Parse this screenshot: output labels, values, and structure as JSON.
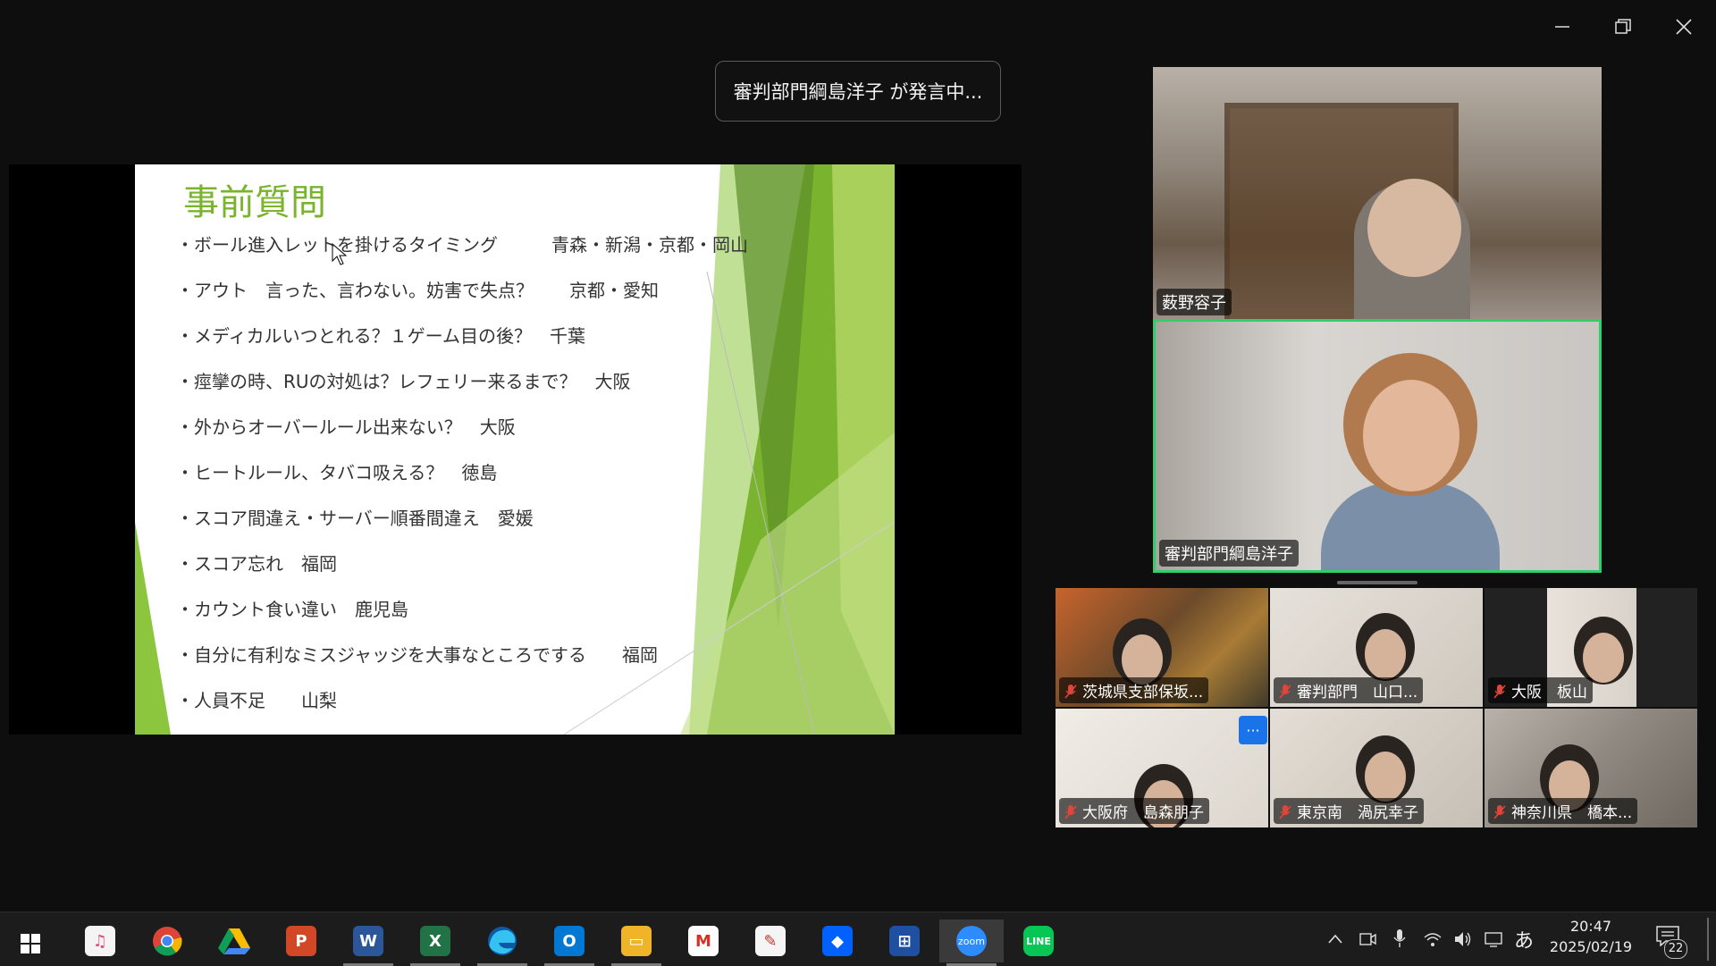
{
  "banner": {
    "text": "審判部門綱島洋子 が発言中..."
  },
  "slide": {
    "title": "事前質問",
    "questions": [
      "・ボール進入レットを掛けるタイミング　　　青森・新潟・京都・岡山",
      "・アウト　言った、言わない。妨害で失点？　　京都・愛知",
      "・メディカルいつとれる？１ゲーム目の後？　千葉",
      "・痙攣の時、RUの対処は？レフェリー来るまで？　大阪",
      "・外からオーバールール出来ない？　大阪",
      "・ヒートルール、タバコ吸える？　徳島",
      "・スコア間違え・サーバー順番間違え　愛媛",
      "・スコア忘れ　福岡",
      "・カウント食い違い　鹿児島",
      "・自分に有利なミスジャッジを大事なところでする　　福岡",
      "・人員不足　　山梨"
    ]
  },
  "participants": {
    "large": [
      {
        "name": "薮野容子"
      },
      {
        "name": "審判部門綱島洋子"
      }
    ],
    "small": [
      {
        "name": "茨城県支部保坂..."
      },
      {
        "name": "審判部門　山口..."
      },
      {
        "name": "大阪　板山"
      },
      {
        "name": "大阪府　島森朋子"
      },
      {
        "name": "東京南　渦尻幸子"
      },
      {
        "name": "神奈川県　橋本..."
      }
    ],
    "more_button": "···"
  },
  "taskbar": {
    "clock_time": "20:47",
    "clock_date": "2025/02/19",
    "ime": "あ",
    "notifications": "22",
    "apps": [
      "itunes-icon",
      "chrome-icon",
      "drive-icon",
      "powerpoint-icon",
      "word-icon",
      "excel-icon",
      "edge-icon",
      "outlook-icon",
      "explorer-icon",
      "gmail-icon",
      "notepad-icon",
      "dropbox-icon",
      "network-icon",
      "zoom-icon",
      "line-icon"
    ],
    "zoom_label": "zoom",
    "line_label": "LINE"
  },
  "colors": {
    "active_speaker": "#2fd06b",
    "slide_green": "#7ab32e",
    "accent_blue": "#1a73e8"
  }
}
